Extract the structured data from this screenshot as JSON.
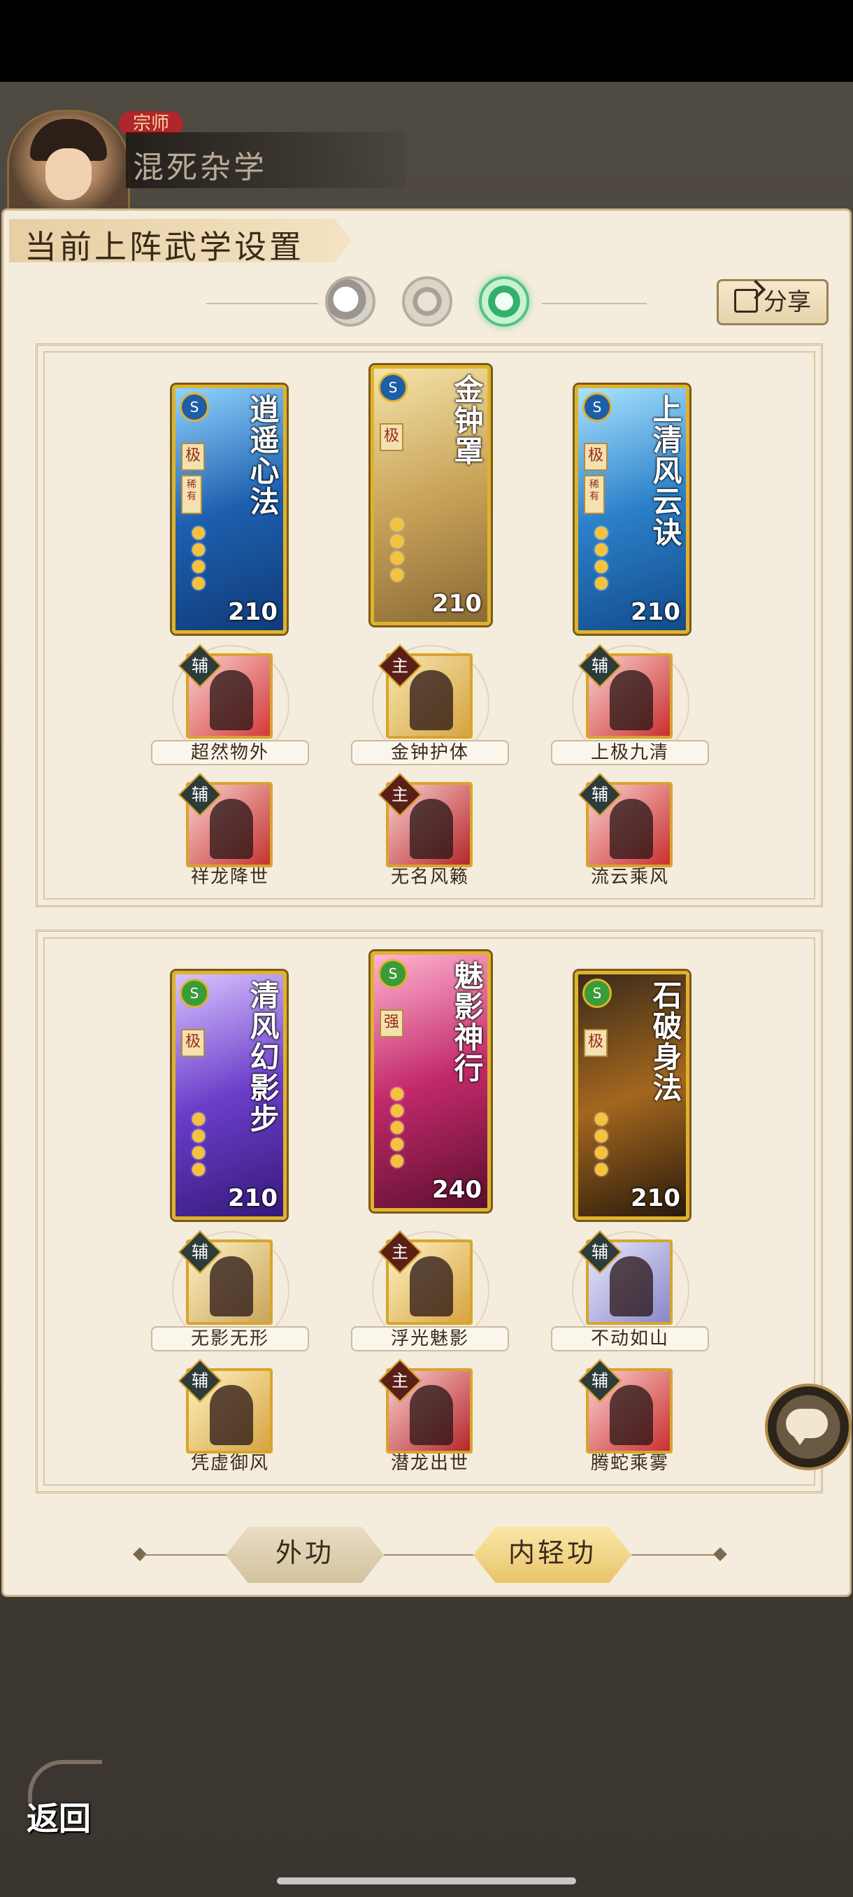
{
  "profile": {
    "rank": "宗师",
    "name": "混死杂学"
  },
  "panel": {
    "title": "当前上阵武学设置"
  },
  "share": {
    "label": "分享"
  },
  "group1": {
    "cards": [
      {
        "name": "逍遥心法",
        "grade": "极",
        "rarity": "稀有",
        "power": "210"
      },
      {
        "name": "金钟罩",
        "grade": "极",
        "rarity": "",
        "power": "210"
      },
      {
        "name": "上清风云诀",
        "grade": "极",
        "rarity": "稀有",
        "power": "210"
      }
    ],
    "skills_row1": [
      {
        "role": "辅",
        "label": "超然物外"
      },
      {
        "role": "主",
        "label": "金钟护体"
      },
      {
        "role": "辅",
        "label": "上极九清"
      }
    ],
    "skills_row2": [
      {
        "role": "辅",
        "label": "祥龙降世"
      },
      {
        "role": "主",
        "label": "无名风籁"
      },
      {
        "role": "辅",
        "label": "流云乘风"
      }
    ]
  },
  "group2": {
    "cards": [
      {
        "name": "清风幻影步",
        "grade": "极",
        "rarity": "",
        "power": "210"
      },
      {
        "name": "魅影神行",
        "grade": "强",
        "rarity": "",
        "power": "240"
      },
      {
        "name": "石破身法",
        "grade": "极",
        "rarity": "",
        "power": "210"
      }
    ],
    "skills_row1": [
      {
        "role": "辅",
        "label": "无影无形"
      },
      {
        "role": "主",
        "label": "浮光魅影"
      },
      {
        "role": "辅",
        "label": "不动如山"
      }
    ],
    "skills_row2": [
      {
        "role": "辅",
        "label": "凭虚御风"
      },
      {
        "role": "主",
        "label": "潜龙出世"
      },
      {
        "role": "辅",
        "label": "腾蛇乘雾"
      }
    ]
  },
  "tabs": {
    "outer": "外功",
    "inner": "内轻功"
  },
  "back": {
    "label": "返回"
  },
  "icons": [
    "moon-icon",
    "gear-icon",
    "jade-icon",
    "share-icon",
    "chat-icon",
    "back-arrow-icon"
  ]
}
